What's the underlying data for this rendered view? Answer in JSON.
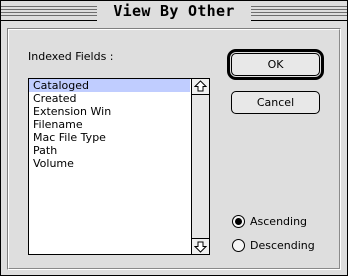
{
  "window": {
    "title": "View By Other"
  },
  "fields": {
    "label": "Indexed Fields :",
    "items": [
      "Cataloged",
      "Created",
      "Extension Win",
      "Filename",
      "Mac File Type",
      "Path",
      "Volume"
    ],
    "selected_index": 0
  },
  "buttons": {
    "ok": "OK",
    "cancel": "Cancel"
  },
  "sort_order": {
    "ascending": "Ascending",
    "descending": "Descending",
    "selected": "ascending"
  },
  "icons": {
    "scroll_up": "up-arrow-icon",
    "scroll_down": "down-arrow-icon"
  }
}
